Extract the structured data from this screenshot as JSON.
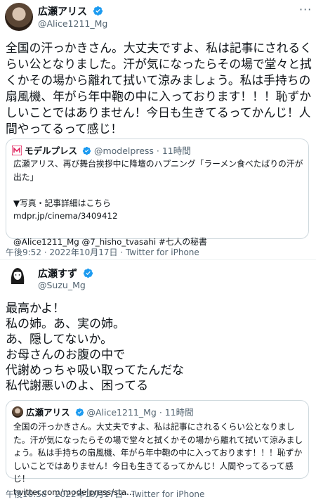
{
  "tweet1": {
    "display_name": "広瀬アリス",
    "handle": "@Alice1211_Mg",
    "more_icon": "more-horizontal-icon",
    "body": "全国の汗っかきさん。大丈夫ですよ、私は記事にされるくらい公となりました。汗が気になったらその場で堂々と拭くかその場から離れて拭いて涼みましょう。私は手持ちの扇風機、年がら年中鞄の中に入っております！！！恥ずかしいことではありません！今日も生きてるってかんじ！人間やってるって感じ！",
    "card": {
      "source_name": "モデルプレス",
      "source_handle": "@modelpress",
      "time_ago": "· 11時間",
      "text": "広瀬アリス、再び舞台挨拶中に降壇のハプニング「ラーメン食べたばりの汗が出た」\n\n▼写真・記事詳細はこちら\nmdpr.jp/cinema/3409412\n\n@Alice1211_Mg @7_hisho_tvasahi #七人の秘書"
    },
    "timestamp": "午後9:52 · 2022年10月17日",
    "via": "· Twitter for iPhone"
  },
  "tweet2": {
    "display_name": "広瀬すず",
    "handle": "@Suzu_Mg",
    "body": "最高かよ！\n私の姉。あ、実の姉。\nあ、隠してないか。\nお母さんのお腹の中で\n代謝めっちゃ吸い取ってたんだな\n私代謝悪いのよ、困ってる",
    "card": {
      "source_name": "広瀬アリス",
      "source_handle": "@Alice1211_Mg",
      "time_ago": "· 11時間",
      "text": "全国の汗っかきさん。大丈夫ですよ、私は記事にされるくらい公となりました。汗が気になったらその場で堂々と拭くかその場から離れて拭いて涼みましょう。私は手持ちの扇風機、年がら年中鞄の中に入っております！！！恥ずかしいことではありません！今日も生きてるってかんじ！人間やってるって感じ！\ntwitter.com/modelpress/sta..."
    },
    "timestamp": "午後10:58 · 2022年10月17日",
    "via": "· Twitter for iPhone"
  },
  "colors": {
    "verified": "#1d9bf0",
    "muted": "#536471",
    "border": "#cfd9de",
    "modelpress_icon": "#e0245e"
  }
}
